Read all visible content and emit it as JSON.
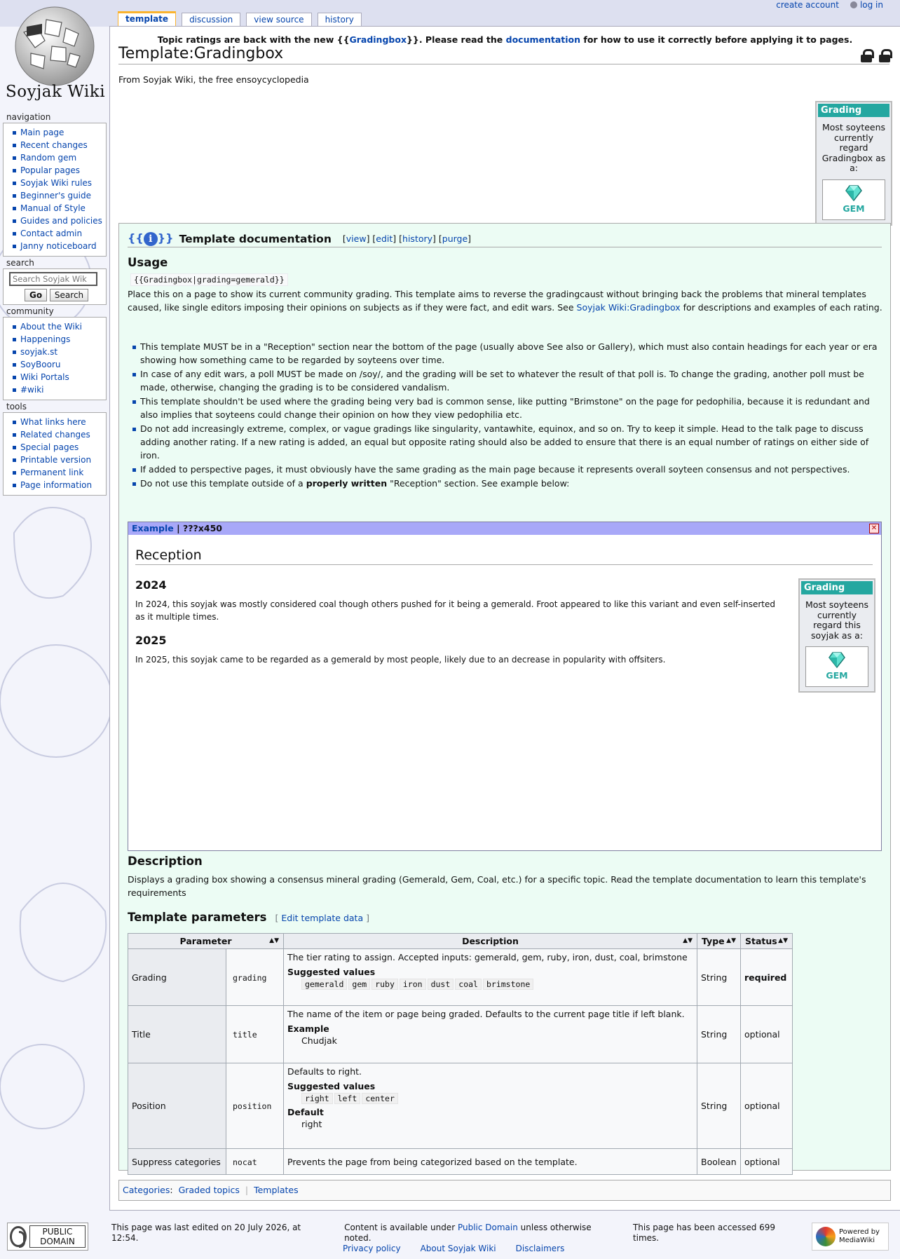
{
  "site": {
    "logo_text": "Soyjak Wiki"
  },
  "tabs": [
    {
      "label": "template"
    },
    {
      "label": "discussion"
    },
    {
      "label": "view source"
    },
    {
      "label": "history"
    }
  ],
  "personal": {
    "create_account": "create account",
    "log_in": "log in"
  },
  "sidebar": {
    "navigation": {
      "heading": "navigation",
      "items": [
        "Main page",
        "Recent changes",
        "Random gem",
        "Popular pages",
        "Soyjak Wiki rules",
        "Beginner's guide",
        "Manual of Style",
        "Guides and policies",
        "Contact admin",
        "Janny noticeboard"
      ]
    },
    "search": {
      "heading": "search",
      "placeholder": "Search Soyjak Wik",
      "go": "Go",
      "search": "Search"
    },
    "community": {
      "heading": "community",
      "items": [
        "About the Wiki",
        "Happenings",
        "soyjak.st",
        "SoyBooru",
        "Wiki Portals",
        "#wiki"
      ]
    },
    "tools": {
      "heading": "tools",
      "items": [
        "What links here",
        "Related changes",
        "Special pages",
        "Printable version",
        "Permanent link",
        "Page information"
      ]
    }
  },
  "sitenotice": {
    "pre": "Topic ratings are back with the new {{",
    "link": "Gradingbox",
    "mid": "}}. Please read the ",
    "link2": "documentation",
    "post": " for how to use it correctly before applying it to pages."
  },
  "page": {
    "title": "Template:Gradingbox",
    "subtitle": "From Soyjak Wiki, the free ensoycyclopedia"
  },
  "gradebox_top": {
    "header": "Grading",
    "text": "Most soyteens currently regard Gradingbox as a:",
    "grade": "GEM"
  },
  "doc": {
    "title": "Template documentation",
    "links": {
      "view": "view",
      "edit": "edit",
      "history": "history",
      "purge": "purge"
    },
    "usage_heading": "Usage",
    "usage_code": "{{Gradingbox|grading=gemerald}}",
    "usage_para_pre": "Place this on a page to show its current community grading. This template aims to reverse the gradingcaust without bringing back the problems that mineral templates caused, like single editors imposing their opinions on subjects as if they were fact, and edit wars. See ",
    "usage_para_link": "Soyjak Wiki:Gradingbox",
    "usage_para_post": " for descriptions and examples of each rating.",
    "bullets": [
      "This template MUST be in a \"Reception\" section near the bottom of the page (usually above See also or Gallery), which must also contain headings for each year or era showing how something came to be regarded by soyteens over time.",
      "In case of any edit wars, a poll MUST be made on /soy/, and the grading will be set to whatever the result of that poll is. To change the grading, another poll must be made, otherwise, changing the grading is to be considered vandalism.",
      "This template shouldn't be used where the grading being very bad is common sense, like putting \"Brimstone\" on the page for pedophilia, because it is redundant and also implies that soyteens could change their opinion on how they view pedophilia etc.",
      "Do not add increasingly extreme, complex, or vague gradings like singularity, vantawhite, equinox, and so on. Try to keep it simple. Head to the talk page to discuss adding another rating. If a new rating is added, an equal but opposite rating should also be added to ensure that there is an equal number of ratings on either side of iron.",
      "If added to perspective pages, it must obviously have the same grading as the main page because it represents overall soyteen consensus and not perspectives."
    ],
    "last_bullet_pre": "Do not use this template outside of a ",
    "last_bullet_bold": "properly written",
    "last_bullet_post": " \"Reception\" section. See example below:",
    "example": {
      "link": "Example",
      "size": " | ???x450",
      "reception": "Reception",
      "h2024": "2024",
      "p2024": "In 2024, this soyjak was mostly considered coal though others pushed for it being a gemerald. Froot appeared to like this variant and even self-inserted as it multiple times.",
      "h2025": "2025",
      "p2025": "In 2025, this soyjak came to be regarded as a gemerald by most people, likely due to an decrease in popularity with offsiters.",
      "gradebox": {
        "header": "Grading",
        "text": "Most soyteens currently regard this soyjak as a:",
        "grade": "GEM"
      }
    },
    "description_heading": "Description",
    "description": "Displays a grading box showing a consensus mineral grading (Gemerald, Gem, Coal, etc.) for a specific topic. Read the template documentation to learn this template's requirements",
    "params_heading": "Template parameters",
    "edit_template_data": "Edit template data",
    "table": {
      "headers": {
        "parameter": "Parameter",
        "description": "Description",
        "type": "Type",
        "status": "Status"
      },
      "rows": [
        {
          "name": "Grading",
          "key": "grading",
          "desc": "The tier rating to assign. Accepted inputs: gemerald, gem, ruby, iron, dust, coal, brimstone",
          "sub_label": "Suggested values",
          "values": [
            "gemerald",
            "gem",
            "ruby",
            "iron",
            "dust",
            "coal",
            "brimstone"
          ],
          "type": "String",
          "status": "required"
        },
        {
          "name": "Title",
          "key": "title",
          "desc": "The name of the item or page being graded. Defaults to the current page title if left blank.",
          "sub_label": "Example",
          "example": "Chudjak",
          "type": "String",
          "status": "optional"
        },
        {
          "name": "Position",
          "key": "position",
          "desc": "Defaults to right.",
          "sub_label": "Suggested values",
          "values": [
            "right",
            "left",
            "center"
          ],
          "default_label": "Default",
          "default": "right",
          "type": "String",
          "status": "optional"
        },
        {
          "name": "Suppress categories",
          "key": "nocat",
          "desc": "Prevents the page from being categorized based on the template.",
          "type": "Boolean",
          "status": "optional"
        }
      ]
    }
  },
  "categories": {
    "label": "Categories",
    "items": [
      "Graded topics",
      "Templates"
    ]
  },
  "footer": {
    "badge_pd": "PUBLIC DOMAIN",
    "last_edited": "This page was last edited on 20 July 2026, at 12:54.",
    "content_pre": "Content is available under ",
    "content_link": "Public Domain",
    "content_post": " unless otherwise noted.",
    "accessed": "This page has been accessed 699 times.",
    "privacy": "Privacy policy",
    "about": "About Soyjak Wiki",
    "disclaimers": "Disclaimers",
    "powered_1": "Powered by",
    "powered_2": "MediaWiki"
  }
}
